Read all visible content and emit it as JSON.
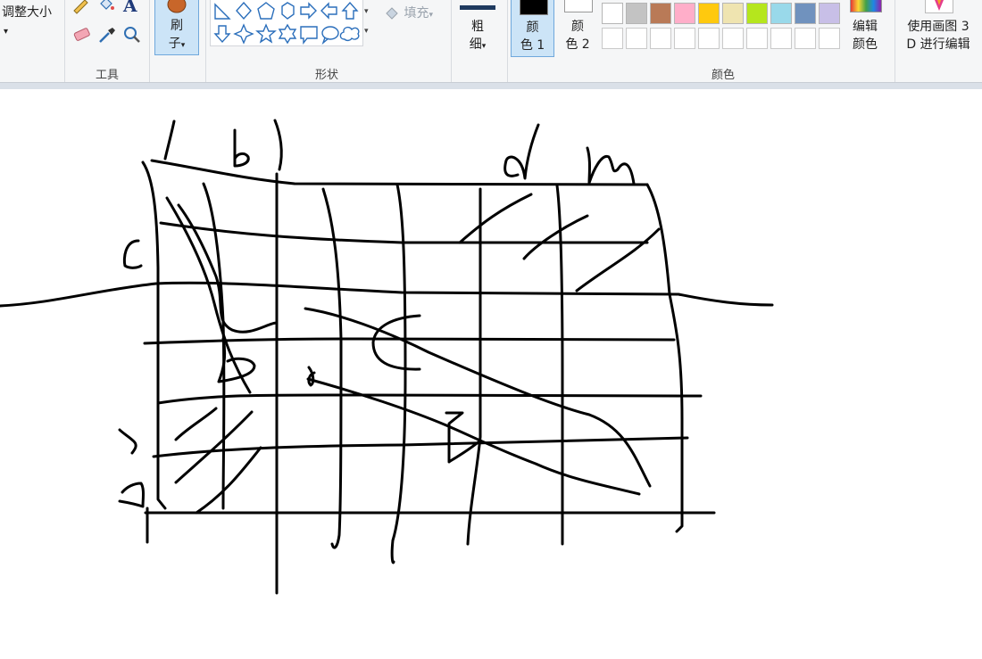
{
  "ribbon": {
    "image_group": {
      "resize_label": "调整大小",
      "more_arrow": "▾"
    },
    "tools_group": {
      "label": "工具",
      "text_tool_glyph": "A"
    },
    "brush": {
      "label_line1": "刷",
      "label_line2": "子",
      "arrow": "▾"
    },
    "shapes_group": {
      "label": "形状",
      "fill_label": "填充",
      "fill_arrow": "▾"
    },
    "size": {
      "label_line1": "粗",
      "label_line2": "细",
      "arrow": "▾"
    },
    "color1": {
      "label_line1": "颜",
      "label_line2": "色 1",
      "value": "#000000"
    },
    "color2": {
      "label_line1": "颜",
      "label_line2": "色 2",
      "value": "#ffffff"
    },
    "colors_group": {
      "label": "颜色",
      "palette_row1": [
        "#ffffff",
        "#c3c3c3",
        "#b97a57",
        "#ffaec9",
        "#ffc90e",
        "#efe4b0",
        "#b5e61d",
        "#99d9ea",
        "#7092be",
        "#c8bfe7"
      ],
      "empty_slots_row2": 10
    },
    "edit_colors": {
      "label_line1": "编辑",
      "label_line2": "颜色"
    },
    "paint3d": {
      "label_line1": "使用画图 3",
      "label_line2": "D 进行编辑"
    }
  },
  "canvas": {
    "ink_color": "#000000"
  }
}
